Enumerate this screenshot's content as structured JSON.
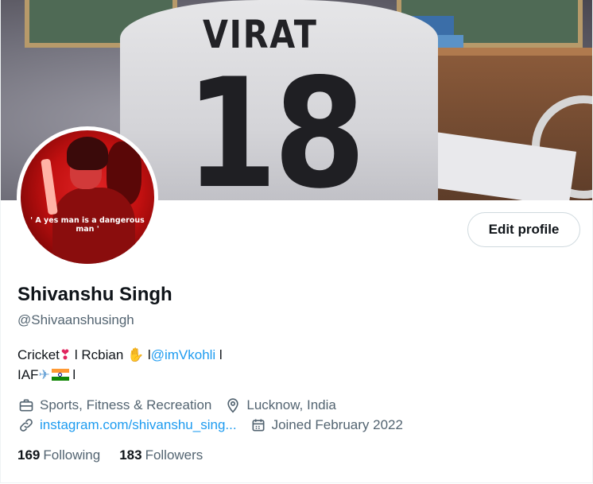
{
  "banner": {
    "jersey_name": "VIRAT",
    "jersey_number": "18"
  },
  "avatar": {
    "quote": "' A yes man is a dangerous man '"
  },
  "actions": {
    "edit_profile_label": "Edit profile"
  },
  "profile": {
    "name": "Shivanshu Singh",
    "handle": "@Shivaanshusingh"
  },
  "bio": {
    "line1_a": "Cricket",
    "emoji_exclamation": "❣",
    "line1_b": " l Rcbian ",
    "emoji_hand": "✋",
    "line1_c": " l",
    "mention": "@imVkohli",
    "line1_d": " l",
    "line2_a": "IAF",
    "emoji_plane": "✈",
    "line2_b": " l"
  },
  "meta": {
    "category": "Sports, Fitness & Recreation",
    "location": "Lucknow, India",
    "website": "instagram.com/shivanshu_sing...",
    "joined": "Joined February 2022",
    "icons": {
      "category": "briefcase-icon",
      "location": "location-pin-icon",
      "website": "link-icon",
      "joined": "calendar-icon"
    }
  },
  "stats": {
    "following_count": "169",
    "following_label": "Following",
    "followers_count": "183",
    "followers_label": "Followers"
  },
  "colors": {
    "accent": "#1d9bf0",
    "text_primary": "#0f1419",
    "text_secondary": "#536471",
    "border": "#cfd9de"
  }
}
